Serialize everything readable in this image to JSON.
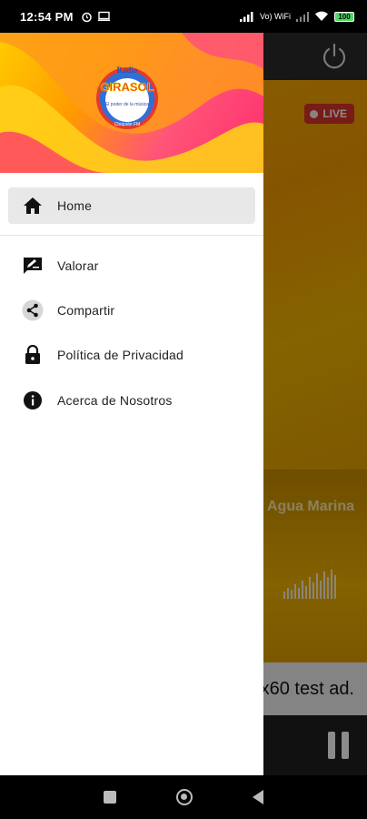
{
  "status_bar": {
    "time": "12:54 PM",
    "network": "Vo) WiFi",
    "battery": "100"
  },
  "background_app": {
    "live_label": "LIVE",
    "now_playing": "Agua Marina",
    "ad_text": "x60 test ad."
  },
  "drawer": {
    "logo": {
      "top_text": "Radio",
      "brand": "GIRASOL",
      "tagline": "El poder de la música",
      "bottom_text": "Chiquián FM"
    },
    "items": [
      {
        "label": "Home",
        "icon": "home-icon",
        "active": true
      },
      {
        "label": "Valorar",
        "icon": "rate-review-icon",
        "active": false
      },
      {
        "label": "Compartir",
        "icon": "share-icon",
        "active": false
      },
      {
        "label": "Política de Privacidad",
        "icon": "lock-icon",
        "active": false
      },
      {
        "label": "Acerca de Nosotros",
        "icon": "info-icon",
        "active": false
      }
    ]
  },
  "colors": {
    "accent_yellow": "#f7b500",
    "header_pink": "#ff2d6f",
    "live_red": "#d9342b"
  }
}
